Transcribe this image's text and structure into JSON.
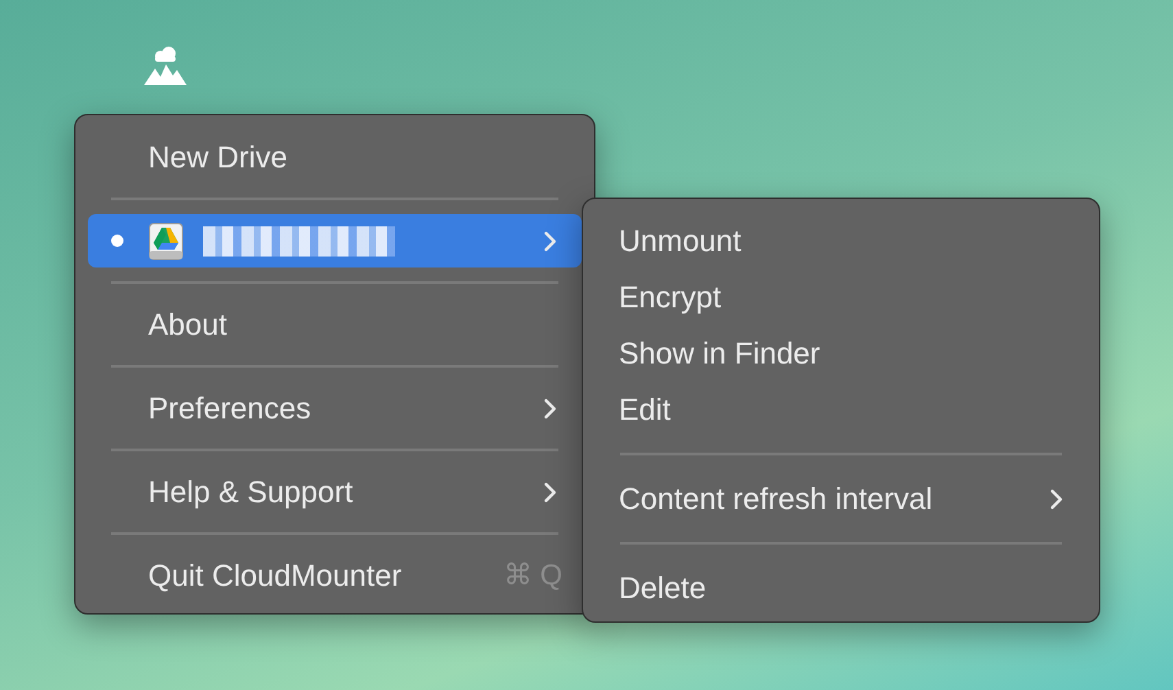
{
  "main_menu": {
    "items": [
      {
        "kind": "item",
        "label": "New Drive",
        "has_submenu": false,
        "selected": false
      },
      {
        "kind": "separator"
      },
      {
        "kind": "drive",
        "marked": true,
        "has_submenu": true,
        "selected": true
      },
      {
        "kind": "separator"
      },
      {
        "kind": "item",
        "label": "About",
        "has_submenu": false,
        "selected": false
      },
      {
        "kind": "separator"
      },
      {
        "kind": "item",
        "label": "Preferences",
        "has_submenu": true,
        "selected": false
      },
      {
        "kind": "separator"
      },
      {
        "kind": "item",
        "label": "Help & Support",
        "has_submenu": true,
        "selected": false
      },
      {
        "kind": "separator"
      },
      {
        "kind": "item",
        "label": "Quit CloudMounter",
        "shortcut": "⌘ Q",
        "has_submenu": false,
        "selected": false
      }
    ]
  },
  "submenu": {
    "items": [
      {
        "kind": "item",
        "label": "Unmount",
        "has_submenu": false
      },
      {
        "kind": "item",
        "label": "Encrypt",
        "has_submenu": false
      },
      {
        "kind": "item",
        "label": "Show in Finder",
        "has_submenu": false
      },
      {
        "kind": "item",
        "label": "Edit",
        "has_submenu": false
      },
      {
        "kind": "separator"
      },
      {
        "kind": "item",
        "label": "Content refresh interval",
        "has_submenu": true
      },
      {
        "kind": "separator"
      },
      {
        "kind": "item",
        "label": "Delete",
        "has_submenu": false
      }
    ]
  }
}
